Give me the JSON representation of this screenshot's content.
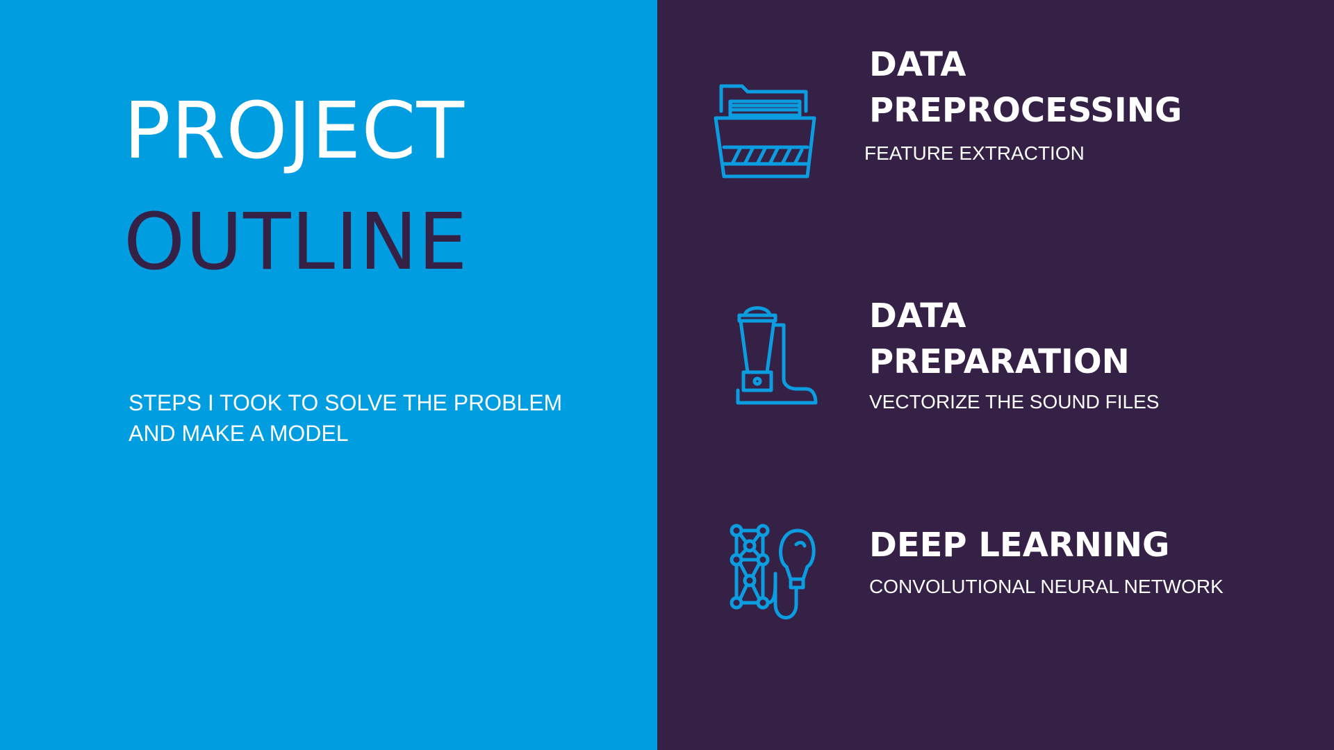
{
  "left_panel": {
    "title_line1": "PROJECT",
    "title_line2": "OUTLINE",
    "subtitle_line1": "STEPS I TOOK TO SOLVE THE PROBLEM",
    "subtitle_line2": "AND MAKE A MODEL"
  },
  "steps": [
    {
      "title_line1": "DATA",
      "title_line2": "PREPROCESSING",
      "description": "FEATURE EXTRACTION",
      "icon": "file-folder-icon"
    },
    {
      "title_line1": "DATA",
      "title_line2": "PREPARATION",
      "description": "VECTORIZE THE SOUND FILES",
      "icon": "blender-icon"
    },
    {
      "title_line1": "DEEP LEARNING",
      "description": "CONVOLUTIONAL NEURAL NETWORK",
      "icon": "neural-network-lightbulb-icon"
    }
  ],
  "colors": {
    "left_bg": "#009de0",
    "right_bg": "#352146",
    "icon": "#0b9de0",
    "text": "#ffffff"
  }
}
